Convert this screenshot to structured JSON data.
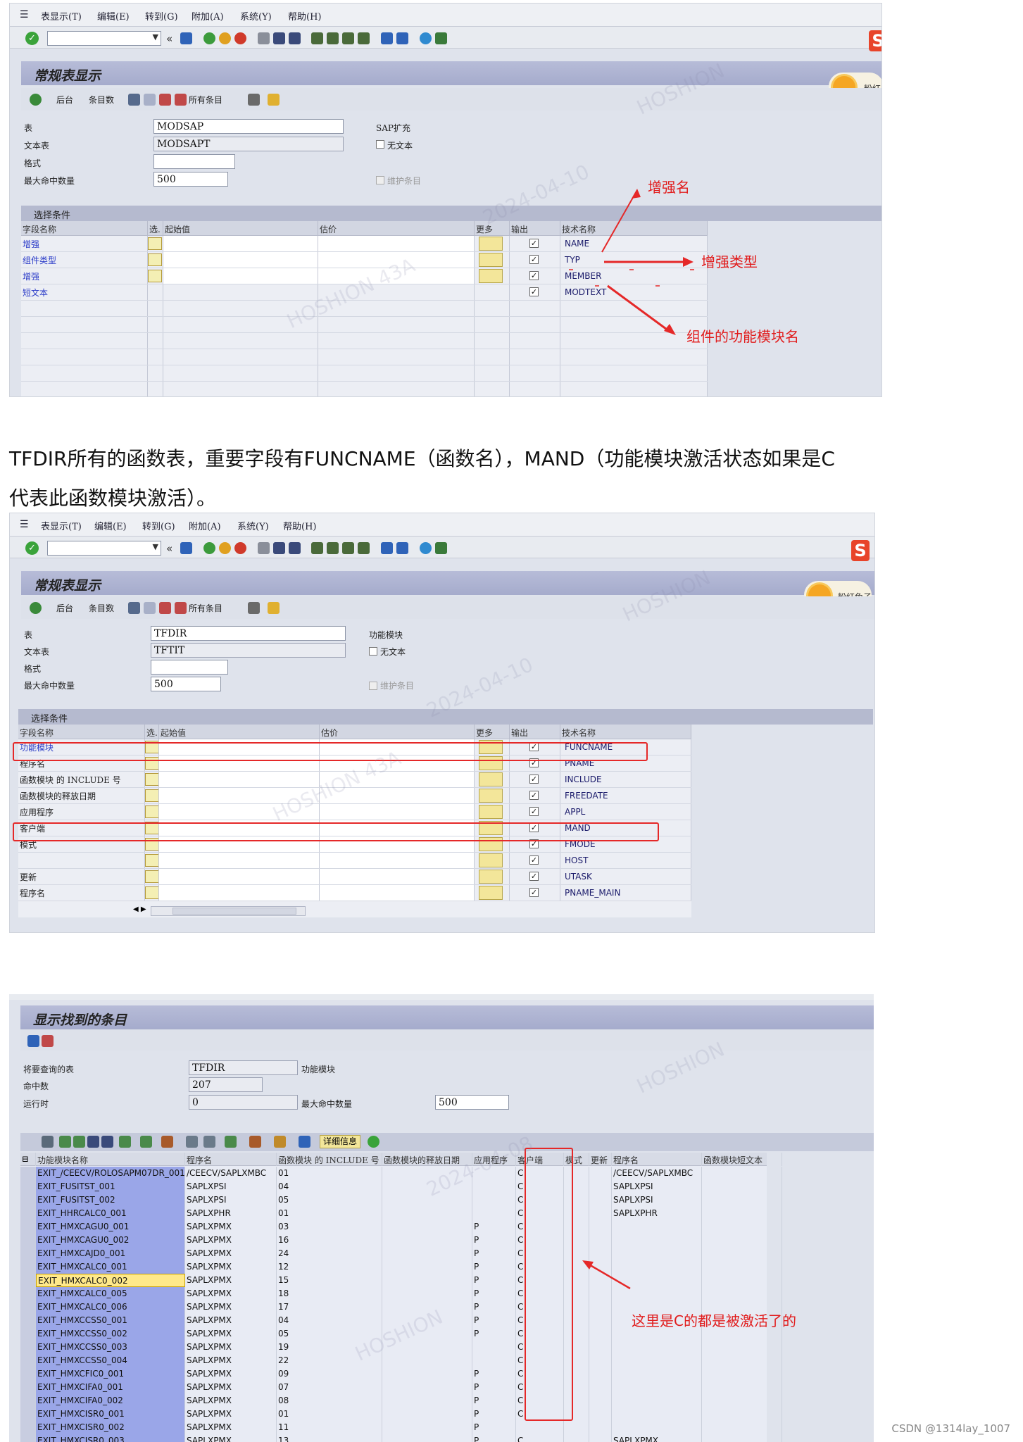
{
  "menu": [
    "表显示(T)",
    "编辑(E)",
    "转到(G)",
    "附加(A)",
    "系统(Y)",
    "帮助(H)"
  ],
  "apptb": {
    "back": "后台",
    "count": "条目数",
    "all": "所有条目"
  },
  "badge": {
    "s1": "粉红兔",
    "s2": "粉红兔子"
  },
  "s1": {
    "title": "常规表显示",
    "table_label": "表",
    "table_value": "MODSAP",
    "table_desc": "SAP扩充",
    "text_label": "文本表",
    "text_value": "MODSAPT",
    "notext": "无文本",
    "format_label": "格式",
    "max_label": "最大命中数量",
    "max_value": "500",
    "maint": "维护条目",
    "sel": "选择条件",
    "cols": [
      "字段名称",
      "选.",
      "起始值",
      "估价",
      "更多",
      "输出",
      "技术名称"
    ],
    "rows": [
      {
        "name": "增强",
        "tech": "NAME",
        "sel": true
      },
      {
        "name": "组件类型",
        "tech": "TYP",
        "sel": true
      },
      {
        "name": "增强",
        "tech": "MEMBER",
        "sel": true
      },
      {
        "name": "短文本",
        "tech": "MODTEXT",
        "sel": false
      }
    ],
    "ann1": "增强名",
    "ann2": "增强类型",
    "ann3": "组件的功能模块名"
  },
  "paragraph": {
    "line1": "TFDIR所有的函数表，重要字段有FUNCNAME（函数名），MAND（功能模块激活状态如果是C",
    "line2": "代表此函数模块激活）。"
  },
  "s2": {
    "title": "常规表显示",
    "table_label": "表",
    "table_value": "TFDIR",
    "table_desc": "功能模块",
    "text_label": "文本表",
    "text_value": "TFTIT",
    "notext": "无文本",
    "format_label": "格式",
    "max_label": "最大命中数量",
    "max_value": "500",
    "maint": "维护条目",
    "sel": "选择条件",
    "cols": [
      "字段名称",
      "选.",
      "起始值",
      "估价",
      "更多",
      "输出",
      "技术名称"
    ],
    "rows": [
      {
        "name": "功能模块",
        "tech": "FUNCNAME"
      },
      {
        "name": "程序名",
        "tech": "PNAME"
      },
      {
        "name": "函数模块 的 INCLUDE 号",
        "tech": "INCLUDE"
      },
      {
        "name": "函数模块的释放日期",
        "tech": "FREEDATE"
      },
      {
        "name": "应用程序",
        "tech": "APPL"
      },
      {
        "name": "客户端",
        "tech": "MAND"
      },
      {
        "name": "模式",
        "tech": "FMODE"
      },
      {
        "name": "",
        "tech": "HOST"
      },
      {
        "name": "更新",
        "tech": "UTASK"
      },
      {
        "name": "程序名",
        "tech": "PNAME_MAIN"
      }
    ]
  },
  "s3": {
    "title": "显示找到的条目",
    "q_label": "将要查询的表",
    "q_value": "TFDIR",
    "q_desc": "功能模块",
    "hits_label": "命中数",
    "hits_value": "207",
    "rt_label": "运行时",
    "rt_value": "0",
    "max_label": "最大命中数量",
    "max_value": "500",
    "detail": "详细信息",
    "cols": [
      "功能模块名称",
      "程序名",
      "函数模块 的 INCLUDE 号",
      "函数模块的释放日期",
      "应用程序",
      "客户端",
      "模式",
      "更新",
      "程序名",
      "函数模块短文本"
    ],
    "rows": [
      [
        "EXIT_/CEECV/ROLOSAPM07DR_001",
        "/CEECV/SAPLXMBC",
        "01",
        "",
        "",
        "C",
        "",
        "",
        "/CEECV/SAPLXMBC",
        ""
      ],
      [
        "EXIT_FUSITST_001",
        "SAPLXPSI",
        "04",
        "",
        "",
        "C",
        "",
        "",
        "SAPLXPSI",
        ""
      ],
      [
        "EXIT_FUSITST_002",
        "SAPLXPSI",
        "05",
        "",
        "",
        "C",
        "",
        "",
        "SAPLXPSI",
        ""
      ],
      [
        "EXIT_HHRCALC0_001",
        "SAPLXPHR",
        "01",
        "",
        "",
        "C",
        "",
        "",
        "SAPLXPHR",
        ""
      ],
      [
        "EXIT_HMXCAGU0_001",
        "SAPLXPMX",
        "03",
        "",
        "P",
        "C",
        "",
        "",
        "",
        ""
      ],
      [
        "EXIT_HMXCAGU0_002",
        "SAPLXPMX",
        "16",
        "",
        "P",
        "C",
        "",
        "",
        "",
        ""
      ],
      [
        "EXIT_HMXCAJD0_001",
        "SAPLXPMX",
        "24",
        "",
        "P",
        "C",
        "",
        "",
        "",
        ""
      ],
      [
        "EXIT_HMXCALC0_001",
        "SAPLXPMX",
        "12",
        "",
        "P",
        "C",
        "",
        "",
        "",
        ""
      ],
      [
        "EXIT_HMXCALC0_002",
        "SAPLXPMX",
        "15",
        "",
        "P",
        "C",
        "",
        "",
        "",
        ""
      ],
      [
        "EXIT_HMXCALC0_005",
        "SAPLXPMX",
        "18",
        "",
        "P",
        "C",
        "",
        "",
        "",
        ""
      ],
      [
        "EXIT_HMXCALC0_006",
        "SAPLXPMX",
        "17",
        "",
        "P",
        "C",
        "",
        "",
        "",
        ""
      ],
      [
        "EXIT_HMXCCSS0_001",
        "SAPLXPMX",
        "04",
        "",
        "P",
        "C",
        "",
        "",
        "",
        ""
      ],
      [
        "EXIT_HMXCCSS0_002",
        "SAPLXPMX",
        "05",
        "",
        "P",
        "C",
        "",
        "",
        "",
        ""
      ],
      [
        "EXIT_HMXCCSS0_003",
        "SAPLXPMX",
        "19",
        "",
        "",
        "C",
        "",
        "",
        "",
        ""
      ],
      [
        "EXIT_HMXCCSS0_004",
        "SAPLXPMX",
        "22",
        "",
        "",
        "C",
        "",
        "",
        "",
        ""
      ],
      [
        "EXIT_HMXCFIC0_001",
        "SAPLXPMX",
        "09",
        "",
        "P",
        "C",
        "",
        "",
        "",
        ""
      ],
      [
        "EXIT_HMXCIFA0_001",
        "SAPLXPMX",
        "07",
        "",
        "P",
        "C",
        "",
        "",
        "",
        ""
      ],
      [
        "EXIT_HMXCIFA0_002",
        "SAPLXPMX",
        "08",
        "",
        "P",
        "C",
        "",
        "",
        "",
        ""
      ],
      [
        "EXIT_HMXCISR0_001",
        "SAPLXPMX",
        "01",
        "",
        "P",
        "C",
        "",
        "",
        "",
        ""
      ],
      [
        "EXIT_HMXCISR0_002",
        "SAPLXPMX",
        "11",
        "",
        "P",
        "",
        "",
        "",
        "",
        ""
      ],
      [
        "EXIT_HMXCISR0_003",
        "SAPLXPMX",
        "13",
        "",
        "P",
        "C",
        "",
        "",
        "SAPLXPMX",
        ""
      ]
    ],
    "ann": "这里是C的都是被激活了的"
  },
  "footer": "CSDN @1314lay_1007"
}
